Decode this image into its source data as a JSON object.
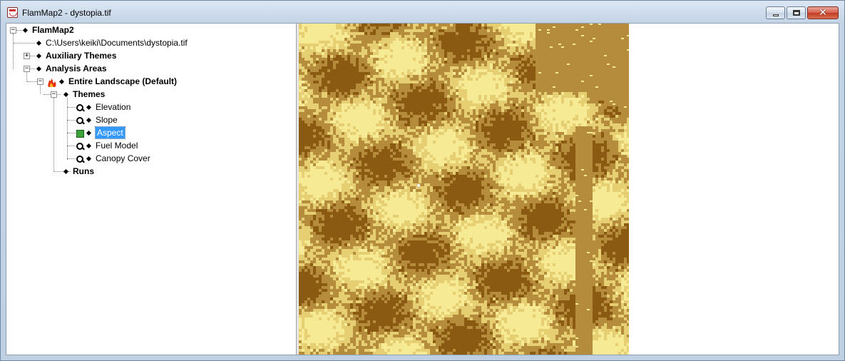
{
  "window": {
    "title": "FlamMap2 - dystopia.tif",
    "minimize_label": "–",
    "maximize_label": "□",
    "close_label": "✕"
  },
  "tree": {
    "root": "FlamMap2",
    "file_path": "C:\\Users\\keiki\\Documents\\dystopia.tif",
    "auxiliary_themes": "Auxiliary Themes",
    "analysis_areas": "Analysis Areas",
    "landscape": "Entire Landscape (Default)",
    "themes": "Themes",
    "theme_items": [
      "Elevation",
      "Slope",
      "Aspect",
      "Fuel Model",
      "Canopy Cover"
    ],
    "selected_theme": "Aspect",
    "runs": "Runs"
  },
  "icons": {
    "app": "flammap-app-icon",
    "landscape": "fire-icon",
    "theme": "magnifier-icon",
    "selected_theme": "green-square-icon"
  },
  "colors": {
    "map_dark": "#8a5a12",
    "map_mid": "#b48c3c",
    "map_light": "#e6cf73",
    "map_bright": "#f6ea95",
    "selection": "#3399ff"
  }
}
